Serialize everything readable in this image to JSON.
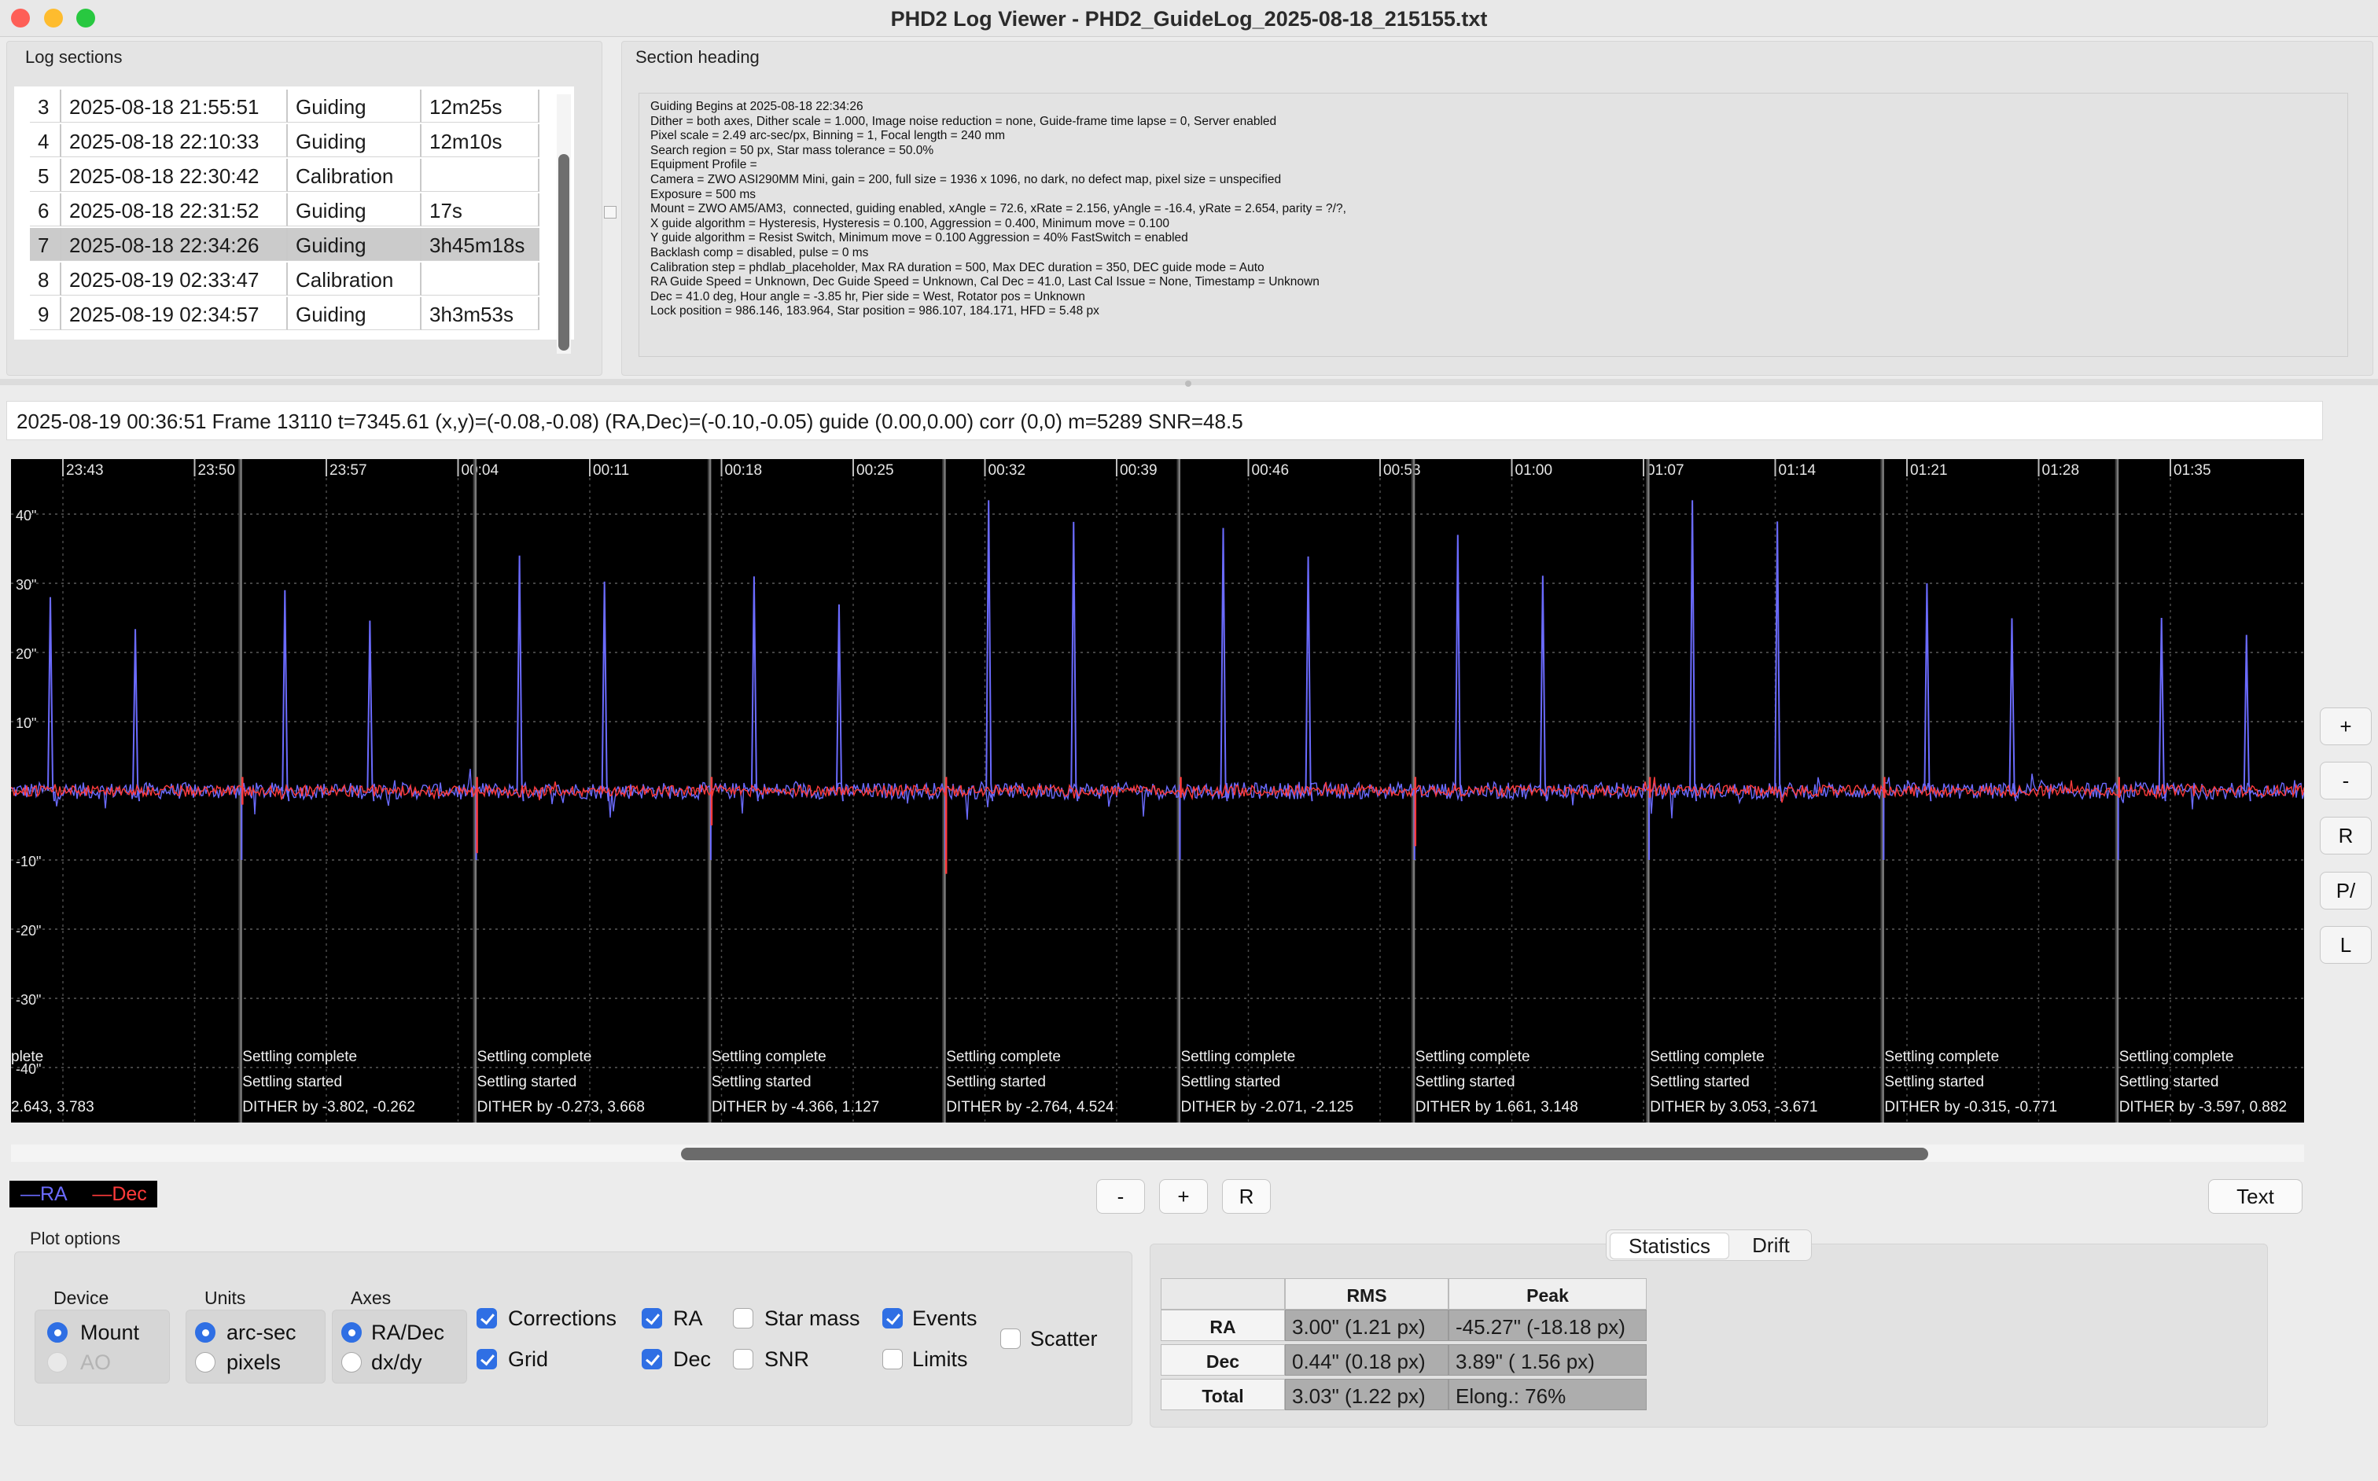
{
  "window": {
    "title": "PHD2 Log Viewer - PHD2_GuideLog_2025-08-18_215155.txt"
  },
  "log_sections": {
    "label": "Log sections",
    "rows": [
      {
        "num": "3",
        "datetime": "2025-08-18 21:55:51",
        "type": "Guiding",
        "duration": "12m25s"
      },
      {
        "num": "4",
        "datetime": "2025-08-18 22:10:33",
        "type": "Guiding",
        "duration": "12m10s"
      },
      {
        "num": "5",
        "datetime": "2025-08-18 22:30:42",
        "type": "Calibration",
        "duration": ""
      },
      {
        "num": "6",
        "datetime": "2025-08-18 22:31:52",
        "type": "Guiding",
        "duration": "17s"
      },
      {
        "num": "7",
        "datetime": "2025-08-18 22:34:26",
        "type": "Guiding",
        "duration": "3h45m18s"
      },
      {
        "num": "8",
        "datetime": "2025-08-19 02:33:47",
        "type": "Calibration",
        "duration": ""
      },
      {
        "num": "9",
        "datetime": "2025-08-19 02:34:57",
        "type": "Guiding",
        "duration": "3h3m53s"
      }
    ],
    "selected_index": 4
  },
  "section_heading": {
    "label": "Section heading",
    "text": "Guiding Begins at 2025-08-18 22:34:26\nDither = both axes, Dither scale = 1.000, Image noise reduction = none, Guide-frame time lapse = 0, Server enabled\nPixel scale = 2.49 arc-sec/px, Binning = 1, Focal length = 240 mm\nSearch region = 50 px, Star mass tolerance = 50.0%\nEquipment Profile =\nCamera = ZWO ASI290MM Mini, gain = 200, full size = 1936 x 1096, no dark, no defect map, pixel size = unspecified\nExposure = 500 ms\nMount = ZWO AM5/AM3,  connected, guiding enabled, xAngle = 72.6, xRate = 2.156, yAngle = -16.4, yRate = 2.654, parity = ?/?,\nX guide algorithm = Hysteresis, Hysteresis = 0.100, Aggression = 0.400, Minimum move = 0.100\nY guide algorithm = Resist Switch, Minimum move = 0.100 Aggression = 40% FastSwitch = enabled\nBacklash comp = disabled, pulse = 0 ms\nCalibration step = phdlab_placeholder, Max RA duration = 500, Max DEC duration = 350, DEC guide mode = Auto\nRA Guide Speed = Unknown, Dec Guide Speed = Unknown, Cal Dec = 41.0, Last Cal Issue = None, Timestamp = Unknown\nDec = 41.0 deg, Hour angle = -3.85 hr, Pier side = West, Rotator pos = Unknown\nLock position = 986.146, 183.964, Star position = 986.107, 184.171, HFD = 5.48 px"
  },
  "status_line": "2025-08-19 00:36:51 Frame 13110 t=7345.61 (x,y)=(-0.08,-0.08) (RA,Dec)=(-0.10,-0.05) guide (0.00,0.00) corr (0,0) m=5289 SNR=48.5",
  "chart_data": {
    "type": "line",
    "x_ticks": [
      "23:43",
      "23:50",
      "23:57",
      "00:04",
      "00:11",
      "00:18",
      "00:25",
      "00:32",
      "00:39",
      "00:46",
      "00:53",
      "01:00",
      "01:07",
      "01:14",
      "01:21",
      "01:28",
      "01:35"
    ],
    "y_ticks": [
      "40\"",
      "30\"",
      "20\"",
      "10\"",
      "",
      "-10\"",
      "-20\"",
      "-30\"",
      "-40\""
    ],
    "ylim": [
      -40,
      40
    ],
    "series": [
      {
        "name": "RA",
        "color": "#6b6bff"
      },
      {
        "name": "Dec",
        "color": "#ff3b3b"
      }
    ],
    "grid": true,
    "dithers": [
      {
        "complete": "plete",
        "started": "",
        "dither": "2.643, 3.783"
      },
      {
        "complete": "Settling complete",
        "started": "Settling started",
        "dither": "DITHER by -3.802, -0.262"
      },
      {
        "complete": "Settling complete",
        "started": "Settling started",
        "dither": "DITHER by -0.273, 3.668"
      },
      {
        "complete": "Settling complete",
        "started": "Settling started",
        "dither": "DITHER by -4.366, 1.127"
      },
      {
        "complete": "Settling complete",
        "started": "Settling started",
        "dither": "DITHER by -2.764, 4.524"
      },
      {
        "complete": "Settling complete",
        "started": "Settling started",
        "dither": "DITHER by -2.071, -2.125"
      },
      {
        "complete": "Settling complete",
        "started": "Settling started",
        "dither": "DITHER by 1.661, 3.148"
      },
      {
        "complete": "Settling complete",
        "started": "Settling started",
        "dither": "DITHER by 3.053, -3.671"
      },
      {
        "complete": "Settling complete",
        "started": "Settling started",
        "dither": "DITHER by -0.315, -0.771"
      },
      {
        "complete": "Settling complete",
        "started": "Settling started",
        "dither": "DITHER by -3.597, 0.882"
      },
      {
        "complete": "Settling",
        "started": "Settling",
        "dither": "DITHER"
      }
    ],
    "ra_spikes": [
      28,
      29,
      34,
      31,
      42,
      38,
      37,
      42,
      30,
      25,
      22
    ]
  },
  "side_buttons": [
    "+",
    "-",
    "R",
    "P/",
    "L"
  ],
  "legend": {
    "ra": "—RA",
    "dec": "—Dec",
    "ra_color": "#6b6bff",
    "dec_color": "#ff3b3b"
  },
  "zoom_buttons": {
    "minus": "-",
    "plus": "+",
    "reset": "R"
  },
  "text_button": "Text",
  "plot_options": {
    "label": "Plot options",
    "device": {
      "label": "Device",
      "mount": "Mount",
      "ao": "AO"
    },
    "units": {
      "label": "Units",
      "arcsec": "arc-sec",
      "pixels": "pixels"
    },
    "axes": {
      "label": "Axes",
      "radec": "RA/Dec",
      "dxdy": "dx/dy"
    },
    "corrections": "Corrections",
    "grid": "Grid",
    "ra": "RA",
    "dec": "Dec",
    "star_mass": "Star mass",
    "snr": "SNR",
    "events": "Events",
    "limits": "Limits",
    "scatter": "Scatter"
  },
  "stats": {
    "tabs": [
      "Statistics",
      "Drift"
    ],
    "headers": [
      "RMS",
      "Peak"
    ],
    "rows": [
      {
        "label": "RA",
        "rms": "3.00\" (1.21 px)",
        "peak": "-45.27\" (-18.18 px)"
      },
      {
        "label": "Dec",
        "rms": "0.44\" (0.18 px)",
        "peak": "3.89\" ( 1.56 px)"
      },
      {
        "label": "Total",
        "rms": "3.03\" (1.22 px)",
        "peak": "Elong.: 76%"
      }
    ]
  }
}
